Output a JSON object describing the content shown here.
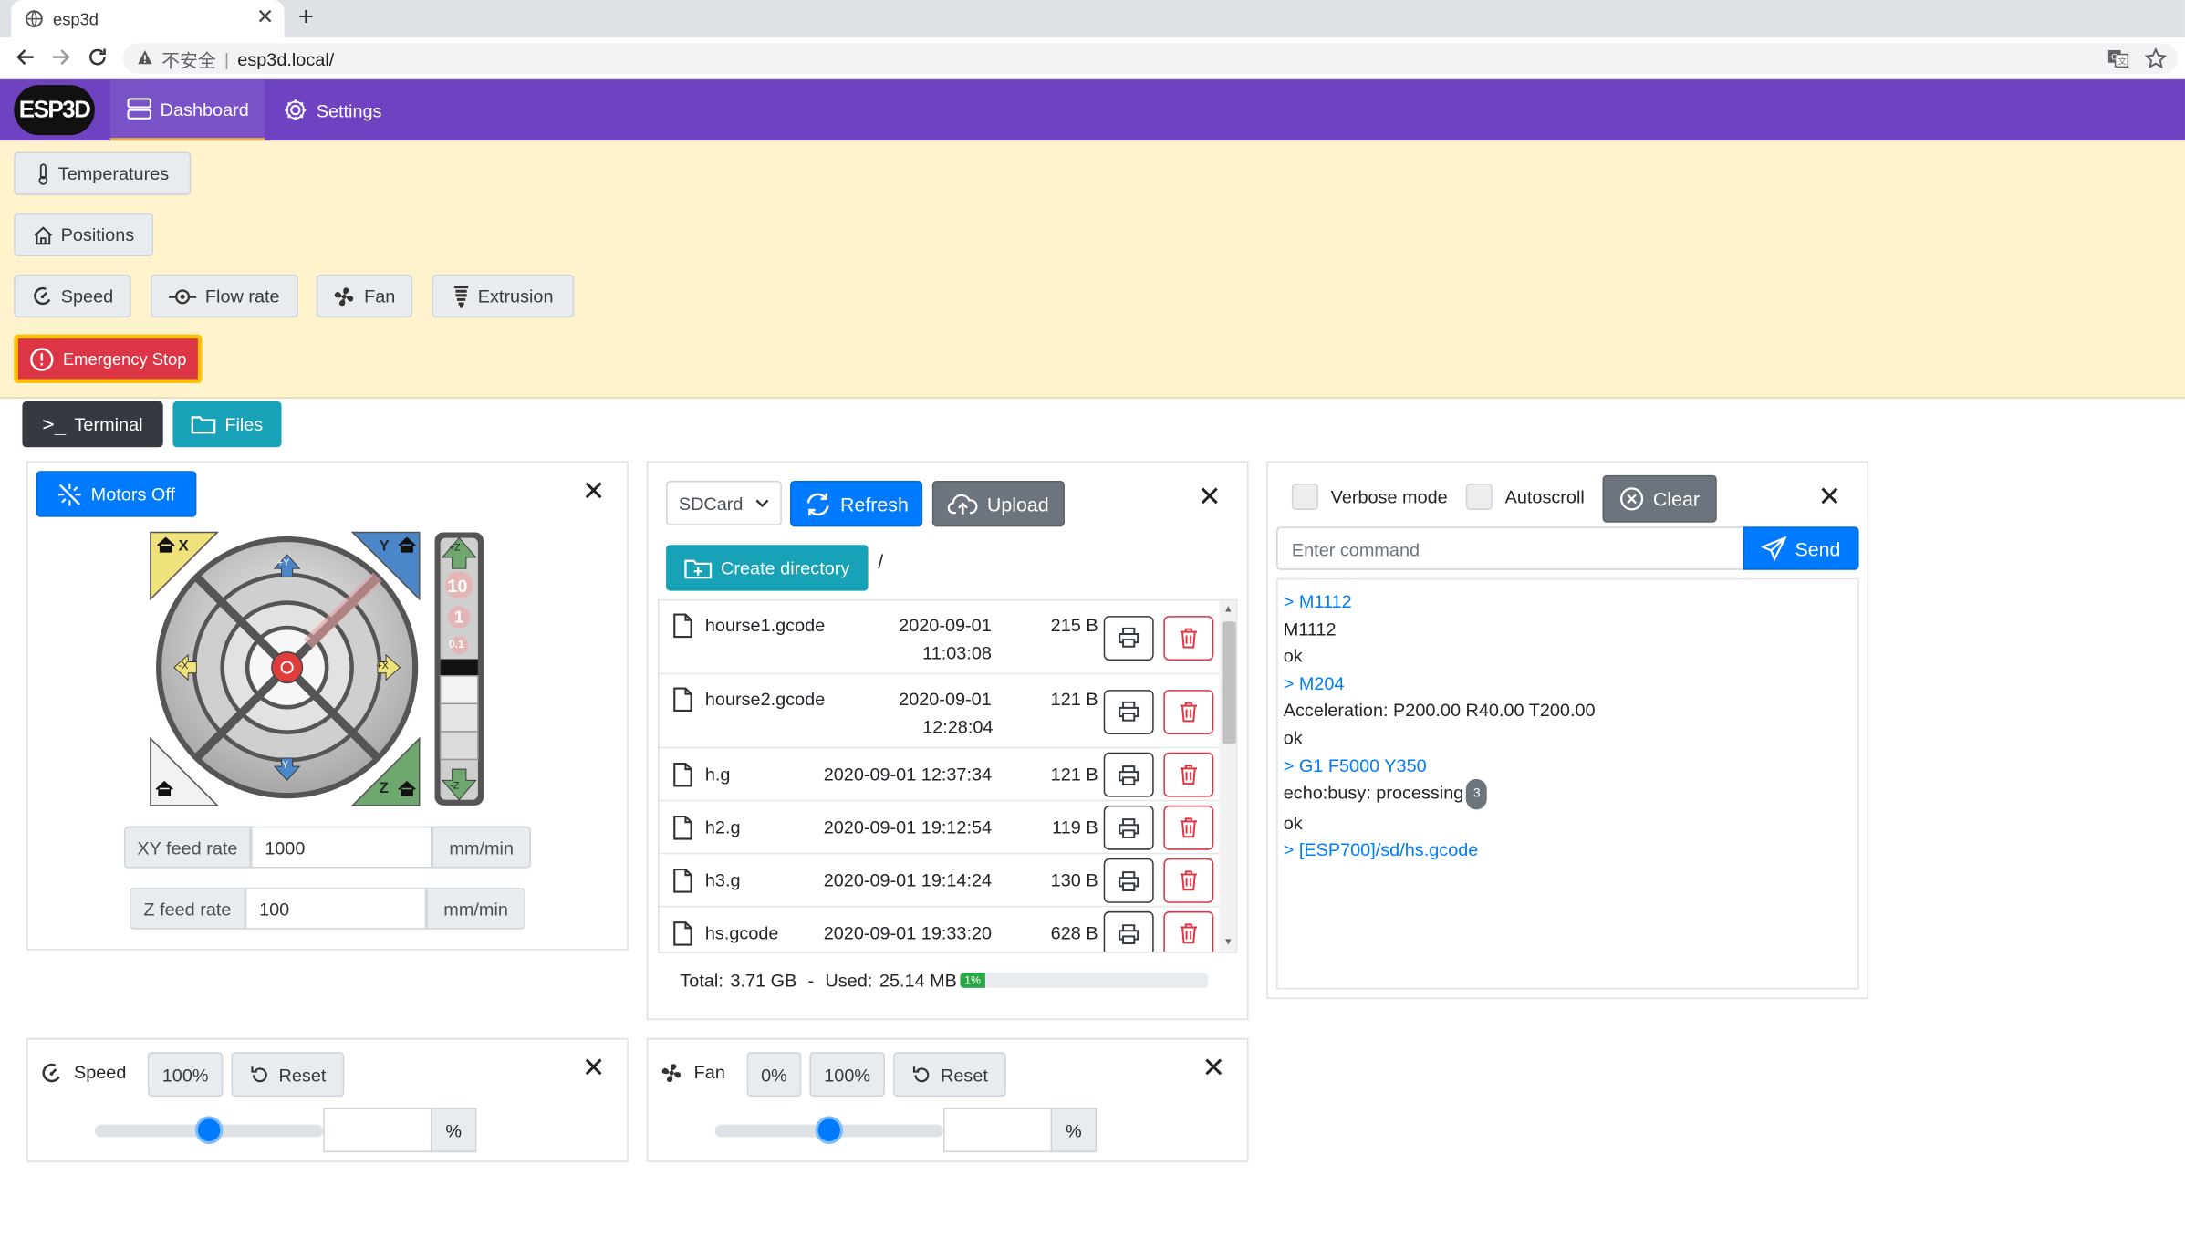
{
  "browser": {
    "tab_title": "esp3d",
    "insecure_label": "不安全",
    "url": "esp3d.local/"
  },
  "nav": {
    "logo": "ESP3D",
    "dashboard": "Dashboard",
    "settings": "Settings"
  },
  "quick": {
    "temperatures": "Temperatures",
    "positions": "Positions",
    "speed": "Speed",
    "flow_rate": "Flow rate",
    "fan": "Fan",
    "extrusion": "Extrusion",
    "emergency_stop": "Emergency Stop"
  },
  "panels": {
    "terminal": "Terminal",
    "files": "Files"
  },
  "jog": {
    "motors_off": "Motors Off",
    "xy_feed_label": "XY feed rate",
    "xy_feed_value": "1000",
    "xy_feed_unit": "mm/min",
    "z_feed_label": "Z feed rate",
    "z_feed_value": "100",
    "z_feed_unit": "mm/min",
    "labels": {
      "home_x": "X",
      "home_y": "Y",
      "home_z": "Z",
      "plus_y": "+Y",
      "minus_y": "-Y",
      "plus_x": "+X",
      "minus_x": "-X",
      "plus_z": "+Z",
      "minus_z": "-Z",
      "step10": "10",
      "step1": "1",
      "step01": "0.1"
    }
  },
  "files": {
    "source": "SDCard",
    "refresh": "Refresh",
    "upload": "Upload",
    "create_dir": "Create directory",
    "path": "/",
    "rows": [
      {
        "name": "hourse1.gcode",
        "date": "2020-09-01",
        "time": "11:03:08",
        "size": "215 B"
      },
      {
        "name": "hourse2.gcode",
        "date": "2020-09-01",
        "time": "12:28:04",
        "size": "121 B"
      },
      {
        "name": "h.g",
        "datetime": "2020-09-01 12:37:34",
        "size": "121 B"
      },
      {
        "name": "h2.g",
        "datetime": "2020-09-01 19:12:54",
        "size": "119 B"
      },
      {
        "name": "h3.g",
        "datetime": "2020-09-01 19:14:24",
        "size": "130 B"
      },
      {
        "name": "hs.gcode",
        "datetime": "2020-09-01 19:33:20",
        "size": "628 B"
      }
    ],
    "total_label": "Total:",
    "total_value": "3.71 GB",
    "sep": "-",
    "used_label": "Used:",
    "used_value": "25.14 MB",
    "used_pct_label": "1%",
    "used_pct": 1
  },
  "terminal": {
    "verbose": "Verbose mode",
    "autoscroll": "Autoscroll",
    "clear": "Clear",
    "placeholder": "Enter command",
    "send": "Send",
    "lines": [
      {
        "t": "> M1112",
        "cmd": true
      },
      {
        "t": "M1112",
        "cmd": false
      },
      {
        "t": "ok",
        "cmd": false
      },
      {
        "t": "> M204",
        "cmd": true
      },
      {
        "t": "Acceleration: P200.00 R40.00 T200.00",
        "cmd": false
      },
      {
        "t": "ok",
        "cmd": false
      },
      {
        "t": "> G1 F5000 Y350",
        "cmd": true
      },
      {
        "t": "echo:busy: processing",
        "cmd": false,
        "badge": "3"
      },
      {
        "t": "ok",
        "cmd": false
      },
      {
        "t": "> [ESP700]/sd/hs.gcode",
        "cmd": true
      }
    ]
  },
  "speed": {
    "label": "Speed",
    "preset": "100%",
    "reset": "Reset",
    "unit": "%",
    "slider_pct": 50
  },
  "fan": {
    "label": "Fan",
    "preset0": "0%",
    "preset100": "100%",
    "reset": "Reset",
    "unit": "%",
    "slider_pct": 50
  },
  "colors": {
    "nav": "#6f42c1",
    "accent_blue": "#007bff",
    "quick_bg": "#fff3cd",
    "danger": "#dc3545"
  }
}
